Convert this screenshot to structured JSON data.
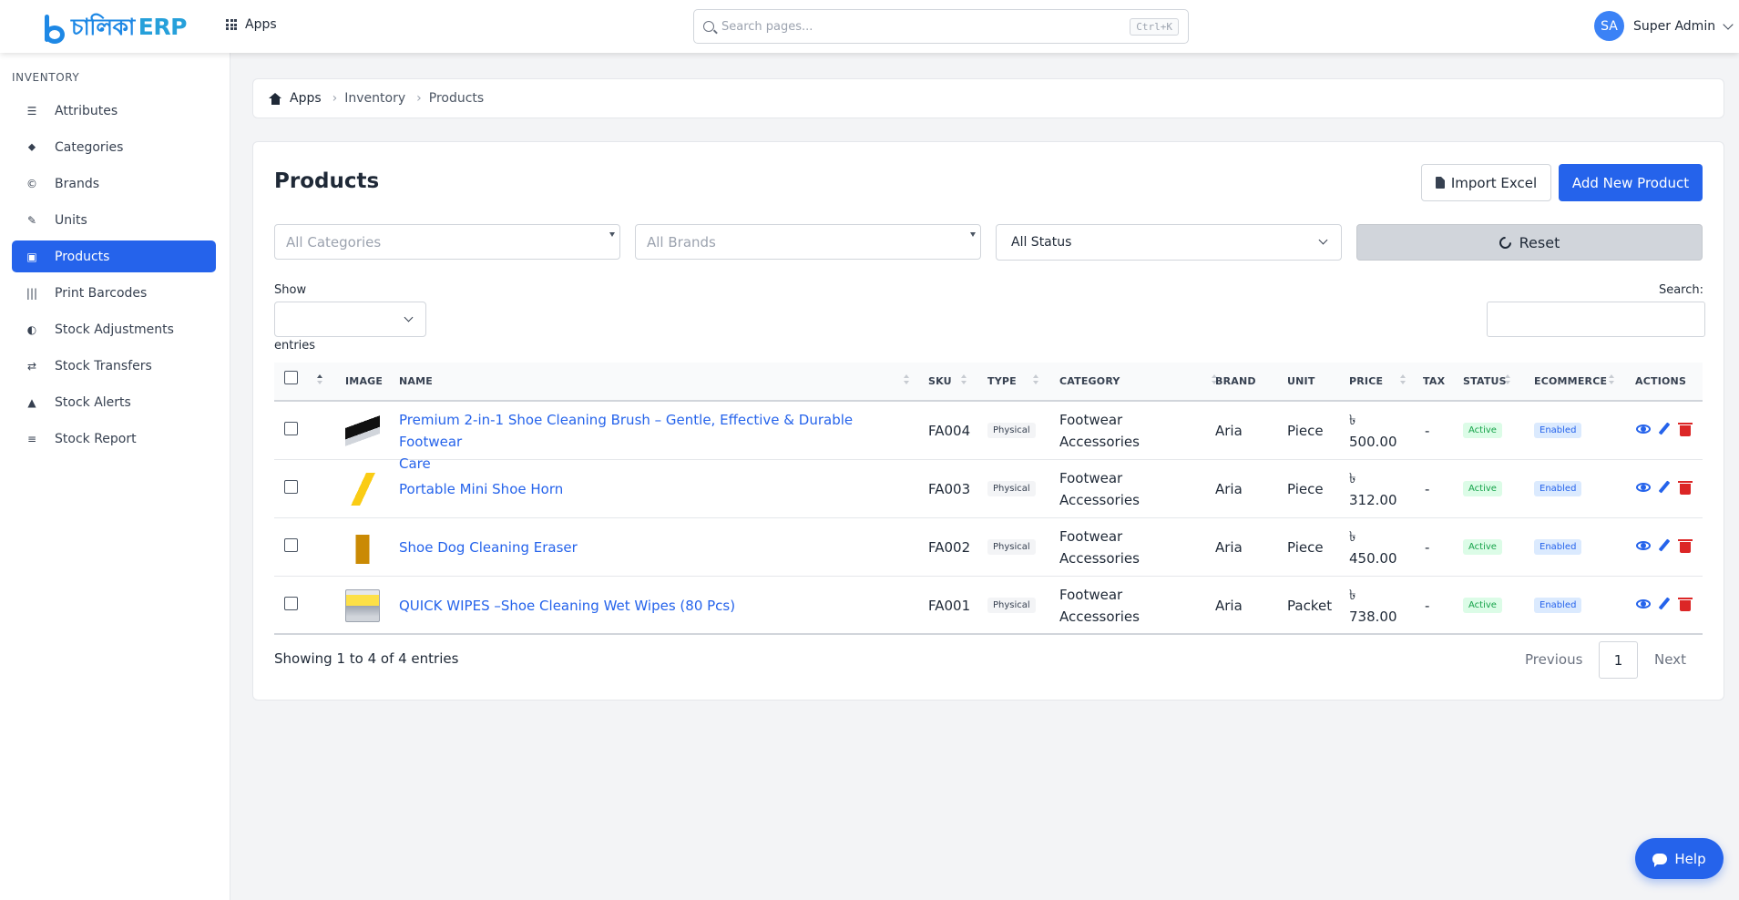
{
  "app": {
    "logo_text": "চালিকা",
    "logo_suffix": "ERP"
  },
  "topbar": {
    "apps_label": "Apps",
    "search_placeholder": "Search pages...",
    "search_shortcut": "Ctrl+K",
    "user_initials": "SA",
    "user_name": "Super Admin"
  },
  "sidebar": {
    "heading": "INVENTORY",
    "items": [
      {
        "label": "Attributes",
        "icon": "sliders-icon",
        "glyph": "☰"
      },
      {
        "label": "Categories",
        "icon": "tags-icon",
        "glyph": "⬥"
      },
      {
        "label": "Brands",
        "icon": "copyright-icon",
        "glyph": "©"
      },
      {
        "label": "Units",
        "icon": "ruler-icon",
        "glyph": "✎"
      },
      {
        "label": "Products",
        "icon": "box-icon",
        "glyph": "▣",
        "active": true
      },
      {
        "label": "Print Barcodes",
        "icon": "barcode-icon",
        "glyph": "|||"
      },
      {
        "label": "Stock Adjustments",
        "icon": "half-circle-icon",
        "glyph": "◐"
      },
      {
        "label": "Stock Transfers",
        "icon": "exchange-icon",
        "glyph": "⇄"
      },
      {
        "label": "Stock Alerts",
        "icon": "warning-icon",
        "glyph": "▲"
      },
      {
        "label": "Stock Report",
        "icon": "chart-icon",
        "glyph": "≡"
      }
    ]
  },
  "breadcrumb": {
    "items": [
      "Apps",
      "Inventory",
      "Products"
    ]
  },
  "page": {
    "title": "Products",
    "import_label": "Import Excel",
    "add_label": "Add New Product",
    "filters": {
      "categories_placeholder": "All Categories",
      "brands_placeholder": "All Brands",
      "status_value": "All Status",
      "reset_label": "Reset"
    },
    "show_label": "Show",
    "entries_label": "entries",
    "search_label": "Search:"
  },
  "table": {
    "columns": [
      "IMAGE",
      "NAME",
      "SKU",
      "TYPE",
      "CATEGORY",
      "BRAND",
      "UNIT",
      "PRICE",
      "TAX",
      "STATUS",
      "ECOMMERCE",
      "ACTIONS"
    ],
    "rows": [
      {
        "name_line1": "Premium 2-in-1 Shoe Cleaning Brush – Gentle, Effective & Durable Footwear",
        "name_line2": "Care",
        "sku": "FA004",
        "type": "Physical",
        "category_line1": "Footwear",
        "category_line2": "Accessories",
        "brand": "Aria",
        "unit": "Piece",
        "currency": "৳",
        "price": "500.00",
        "tax": "-",
        "status": "Active",
        "ecommerce": "Enabled",
        "thumb": "brush"
      },
      {
        "name_line1": "Portable Mini Shoe Horn",
        "name_line2": "",
        "sku": "FA003",
        "type": "Physical",
        "category_line1": "Footwear",
        "category_line2": "Accessories",
        "brand": "Aria",
        "unit": "Piece",
        "currency": "৳",
        "price": "312.00",
        "tax": "-",
        "status": "Active",
        "ecommerce": "Enabled",
        "thumb": "horn"
      },
      {
        "name_line1": "Shoe Dog Cleaning Eraser",
        "name_line2": "",
        "sku": "FA002",
        "type": "Physical",
        "category_line1": "Footwear",
        "category_line2": "Accessories",
        "brand": "Aria",
        "unit": "Piece",
        "currency": "৳",
        "price": "450.00",
        "tax": "-",
        "status": "Active",
        "ecommerce": "Enabled",
        "thumb": "eraser"
      },
      {
        "name_line1": "QUICK WIPES –Shoe Cleaning Wet Wipes (80 Pcs)",
        "name_line2": "",
        "sku": "FA001",
        "type": "Physical",
        "category_line1": "Footwear",
        "category_line2": "Accessories",
        "brand": "Aria",
        "unit": "Packet",
        "currency": "৳",
        "price": "738.00",
        "tax": "-",
        "status": "Active",
        "ecommerce": "Enabled",
        "thumb": "wipes"
      }
    ]
  },
  "pagination": {
    "info": "Showing 1 to 4 of 4 entries",
    "previous": "Previous",
    "current": "1",
    "next": "Next"
  },
  "help": {
    "label": "Help"
  }
}
